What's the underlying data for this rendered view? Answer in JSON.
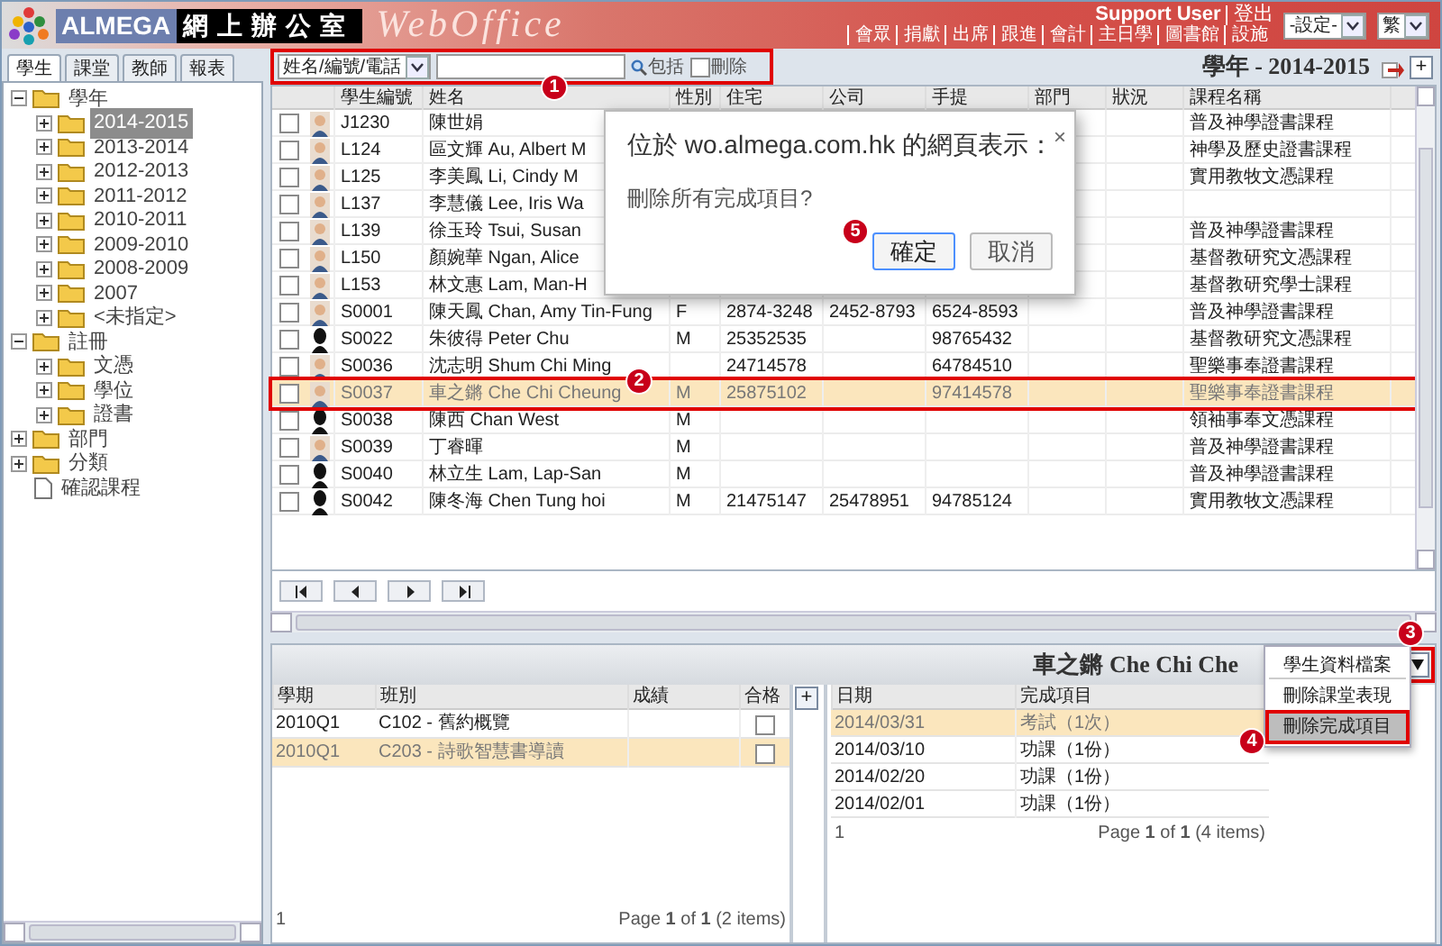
{
  "header": {
    "brand": "ALMEGA",
    "product_cn": "網上辦公室",
    "product": "WebOffice",
    "user": "Support User",
    "logout": "登出",
    "links": [
      "會眾",
      "捐獻",
      "出席",
      "跟進",
      "會計",
      "主日學",
      "圖書館",
      "設施"
    ],
    "settings_select": "-設定-",
    "language_select": "繁"
  },
  "sidebar": {
    "tabs": [
      {
        "label": "學生",
        "selected": true
      },
      {
        "label": "課堂",
        "selected": false
      },
      {
        "label": "教師",
        "selected": false
      },
      {
        "label": "報表",
        "selected": false
      }
    ],
    "tree": [
      {
        "kind": "folder",
        "label": "學年",
        "expanded": true,
        "selected": false,
        "children": [
          {
            "kind": "folder",
            "label": "2014-2015",
            "expanded": false,
            "selected": true
          },
          {
            "kind": "folder",
            "label": "2013-2014",
            "expanded": false,
            "selected": false
          },
          {
            "kind": "folder",
            "label": "2012-2013",
            "expanded": false,
            "selected": false
          },
          {
            "kind": "folder",
            "label": "2011-2012",
            "expanded": false,
            "selected": false
          },
          {
            "kind": "folder",
            "label": "2010-2011",
            "expanded": false,
            "selected": false
          },
          {
            "kind": "folder",
            "label": "2009-2010",
            "expanded": false,
            "selected": false
          },
          {
            "kind": "folder",
            "label": "2008-2009",
            "expanded": false,
            "selected": false
          },
          {
            "kind": "folder",
            "label": "2007",
            "expanded": false,
            "selected": false
          },
          {
            "kind": "folder",
            "label": "<未指定>",
            "expanded": false,
            "selected": false
          }
        ]
      },
      {
        "kind": "folder",
        "label": "註冊",
        "expanded": true,
        "selected": false,
        "children": [
          {
            "kind": "folder",
            "label": "文憑",
            "expanded": false,
            "selected": false
          },
          {
            "kind": "folder",
            "label": "學位",
            "expanded": false,
            "selected": false
          },
          {
            "kind": "folder",
            "label": "證書",
            "expanded": false,
            "selected": false
          }
        ]
      },
      {
        "kind": "folder",
        "label": "部門",
        "expanded": false,
        "selected": false
      },
      {
        "kind": "folder",
        "label": "分類",
        "expanded": false,
        "selected": false
      },
      {
        "kind": "file",
        "label": "確認課程",
        "selected": false
      }
    ]
  },
  "toolbar": {
    "add_button": "+",
    "search_by": "姓名/編號/電話",
    "search_button": "包括",
    "delete_checkbox": {
      "label": "刪除",
      "checked": false
    },
    "year_title": "學年 - 2014-2015"
  },
  "table": {
    "columns": [
      "學生編號",
      "姓名",
      "性別",
      "住宅",
      "公司",
      "手提",
      "部門",
      "狀況",
      "課程名稱"
    ],
    "rows": [
      {
        "checked": false,
        "selected": false,
        "kind": "photo",
        "id": "J1230",
        "name": "陳世娟",
        "course": "普及神學證書課程"
      },
      {
        "checked": false,
        "selected": false,
        "kind": "photo",
        "id": "L124",
        "name": "區文輝 Au, Albert M",
        "course": "神學及歷史證書課程"
      },
      {
        "checked": false,
        "selected": false,
        "kind": "photo",
        "id": "L125",
        "name": "李美鳳 Li, Cindy M",
        "course": "實用教牧文憑課程"
      },
      {
        "checked": false,
        "selected": false,
        "kind": "photo",
        "id": "L137",
        "name": "李慧儀 Lee, Iris Wa"
      },
      {
        "checked": false,
        "selected": false,
        "kind": "photo",
        "id": "L139",
        "name": "徐玉玲 Tsui, Susan",
        "course": "普及神學證書課程"
      },
      {
        "checked": false,
        "selected": false,
        "kind": "photo",
        "id": "L150",
        "name": "顏婉華 Ngan, Alice",
        "course": "基督教研究文憑課程"
      },
      {
        "checked": false,
        "selected": false,
        "kind": "photo",
        "id": "L153",
        "name": "林文惠 Lam, Man-H",
        "course": "基督教研究學士課程"
      },
      {
        "checked": false,
        "selected": false,
        "kind": "photo",
        "id": "S0001",
        "name": "陳天鳳 Chan, Amy Tin-Fung",
        "gender": "F",
        "home": "2874-3248",
        "office": "2452-8793",
        "mobile": "6524-8593",
        "course": "普及神學證書課程"
      },
      {
        "checked": false,
        "selected": false,
        "kind": "silhouette",
        "id": "S0022",
        "name": "朱彼得 Peter Chu",
        "gender": "M",
        "home": "25352535",
        "mobile": "98765432",
        "course": "基督教研究文憑課程"
      },
      {
        "checked": false,
        "selected": false,
        "kind": "photo",
        "id": "S0036",
        "name": "沈志明 Shum Chi Ming",
        "home": "24714578",
        "mobile": "64784510",
        "course": "聖樂事奉證書課程"
      },
      {
        "checked": false,
        "selected": true,
        "kind": "photo",
        "id": "S0037",
        "name": "車之鏘 Che Chi Cheung",
        "gender": "M",
        "home": "25875102",
        "mobile": "97414578",
        "course": "聖樂事奉證書課程"
      },
      {
        "checked": false,
        "selected": false,
        "kind": "silhouette",
        "id": "S0038",
        "name": "陳西 Chan West",
        "gender": "M",
        "course": "領袖事奉文憑課程"
      },
      {
        "checked": false,
        "selected": false,
        "kind": "photo",
        "id": "S0039",
        "name": "丁睿暉",
        "gender": "M",
        "course": "普及神學證書課程"
      },
      {
        "checked": false,
        "selected": false,
        "kind": "silhouette",
        "id": "S0040",
        "name": "林立生 Lam, Lap-San",
        "gender": "M",
        "course": "普及神學證書課程"
      },
      {
        "checked": false,
        "selected": false,
        "kind": "silhouette",
        "id": "S0042",
        "name": "陳冬海 Chen Tung hoi",
        "gender": "M",
        "home": "21475147",
        "office": "25478951",
        "mobile": "94785124",
        "course": "實用教牧文憑課程"
      }
    ]
  },
  "detail": {
    "title": "車之鏘 Che Chi Che",
    "classes": {
      "add_button": "+",
      "columns": [
        "學期",
        "班別",
        "成績",
        "合格"
      ],
      "rows": [
        {
          "term": "2010Q1",
          "class": "C102 - 舊約概覽",
          "passed": false,
          "selected": false
        },
        {
          "term": "2010Q1",
          "class": "C203 - 詩歌智慧書導讀",
          "passed": false,
          "selected": true
        }
      ],
      "page": "1",
      "info": "Page **1** of **1** (2 items)"
    },
    "completions": {
      "columns": [
        "日期",
        "完成項目"
      ],
      "rows": [
        {
          "date": "2014/03/31",
          "item": "考試（1次）",
          "selected": true
        },
        {
          "date": "2014/03/10",
          "item": "功課（1份）",
          "selected": false
        },
        {
          "date": "2014/02/20",
          "item": "功課（1份）",
          "selected": false
        },
        {
          "date": "2014/02/01",
          "item": "功課（1份）",
          "selected": false
        }
      ],
      "page": "1",
      "info": "Page **1** of **1** (4 items)"
    }
  },
  "menu": {
    "items": [
      {
        "label": "學生資料檔案",
        "selected": false
      },
      {
        "label": "刪除課堂表現",
        "selected": false
      },
      {
        "label": "刪除完成項目",
        "selected": true
      }
    ]
  },
  "dialog": {
    "title": "位於 wo.almega.com.hk 的網頁表示：",
    "close": "×",
    "message": "刪除所有完成項目?",
    "ok": "確定",
    "cancel": "取消"
  },
  "annotations": [
    {
      "label": "1"
    },
    {
      "label": "2"
    },
    {
      "label": "3"
    },
    {
      "label": "4"
    },
    {
      "label": "5"
    }
  ]
}
